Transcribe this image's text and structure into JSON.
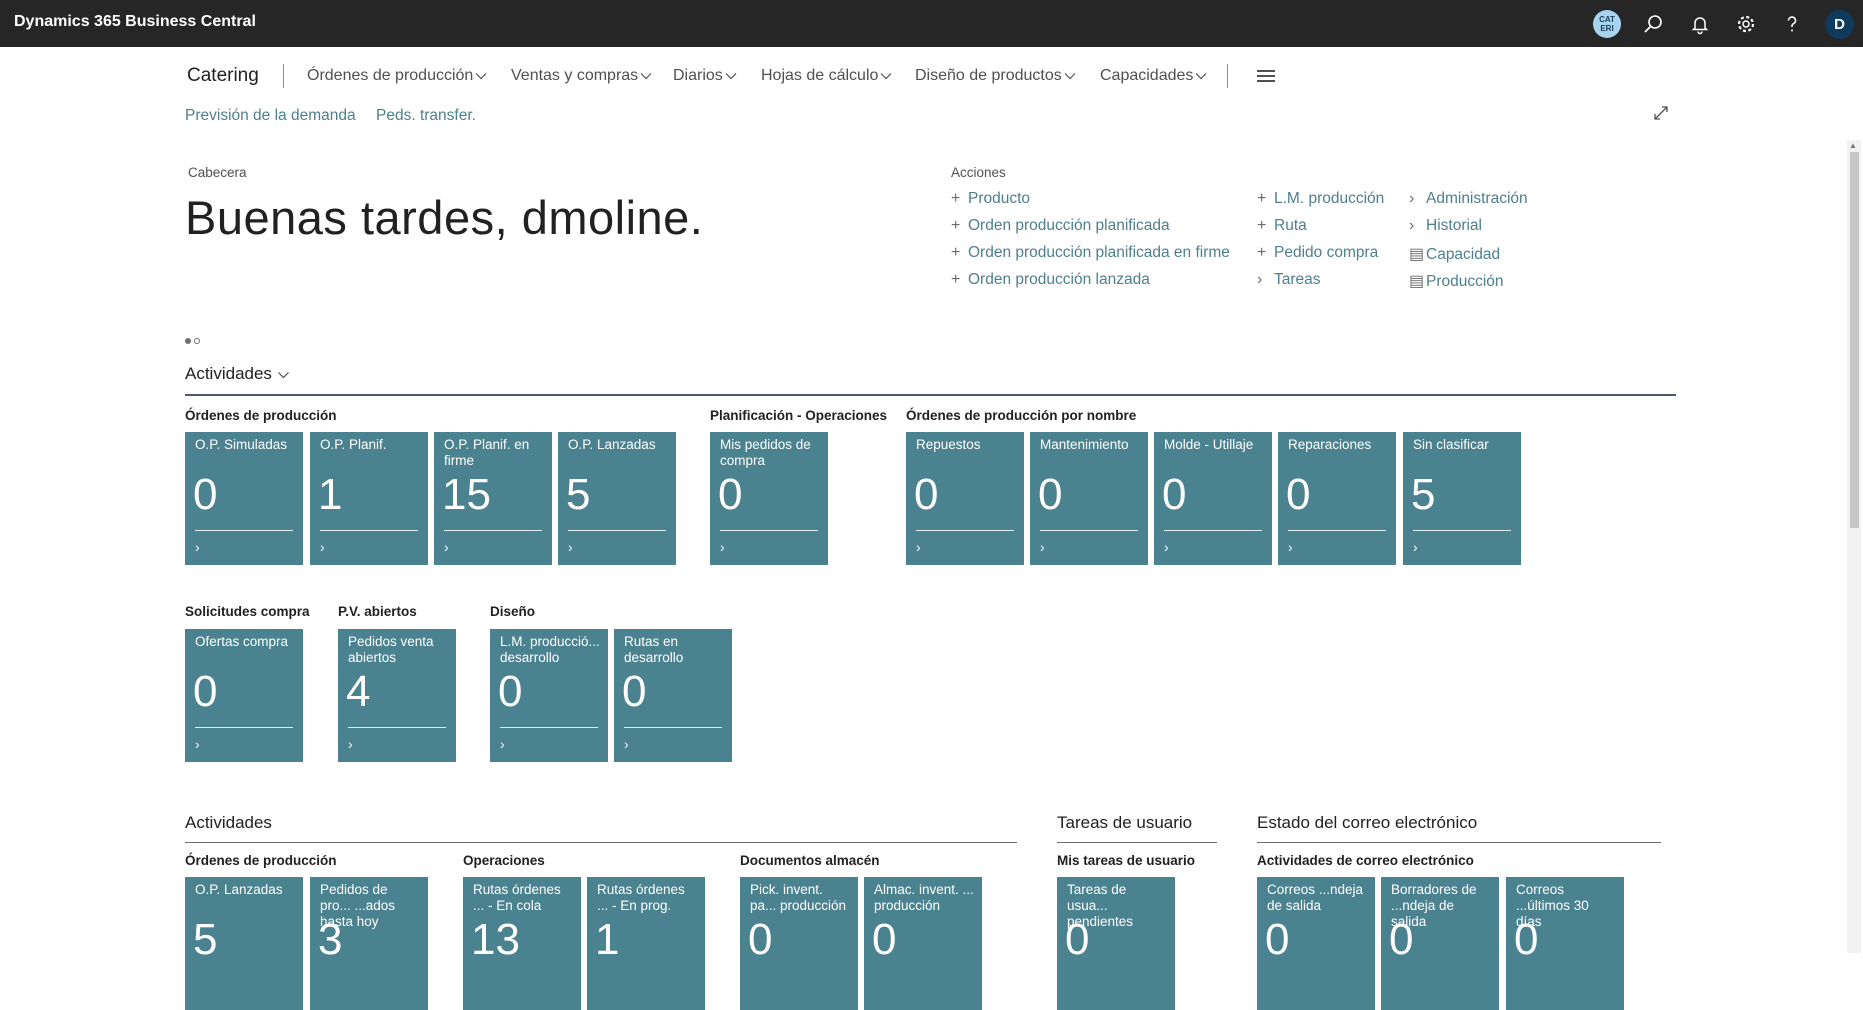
{
  "topbar": {
    "brand": "Dynamics 365 Business Central",
    "company_badge_line1": "CAT",
    "company_badge_line2": "ERI",
    "avatar_initial": "D"
  },
  "nav": {
    "title": "Catering",
    "items": [
      {
        "label": "Órdenes de producción"
      },
      {
        "label": "Ventas y compras"
      },
      {
        "label": "Diarios"
      },
      {
        "label": "Hojas de cálculo"
      },
      {
        "label": "Diseño de productos"
      },
      {
        "label": "Capacidades"
      }
    ],
    "sub_items": [
      "Previsión de la demanda",
      "Peds. transfer."
    ]
  },
  "headline": {
    "label": "Cabecera",
    "greeting": "Buenas tardes, dmoline."
  },
  "actions": {
    "label": "Acciones",
    "col1": [
      "Producto",
      "Orden producción planificada",
      "Orden producción planificada en firme",
      "Orden producción lanzada"
    ],
    "col2": [
      "L.M. producción",
      "Ruta",
      "Pedido compra",
      "Tareas"
    ],
    "col3": [
      "Administración",
      "Historial",
      "Capacidad",
      "Producción"
    ]
  },
  "activities": {
    "title": "Actividades",
    "groups": [
      {
        "label": "Órdenes de producción",
        "tiles": [
          {
            "title": "O.P. Simuladas",
            "value": "0"
          },
          {
            "title": "O.P. Planif.",
            "value": "1"
          },
          {
            "title": "O.P. Planif. en firme",
            "value": "15"
          },
          {
            "title": "O.P. Lanzadas",
            "value": "5"
          }
        ]
      },
      {
        "label": "Planificación - Operaciones",
        "tiles": [
          {
            "title": "Mis pedidos de compra",
            "value": "0"
          }
        ]
      },
      {
        "label": "Órdenes de producción por nombre",
        "tiles": [
          {
            "title": "Repuestos",
            "value": "0"
          },
          {
            "title": "Mantenimiento",
            "value": "0"
          },
          {
            "title": "Molde - Utillaje",
            "value": "0"
          },
          {
            "title": "Reparaciones",
            "value": "0"
          },
          {
            "title": "Sin clasificar",
            "value": "5"
          }
        ]
      },
      {
        "label": "Solicitudes compra",
        "tiles": [
          {
            "title": "Ofertas compra",
            "value": "0"
          }
        ]
      },
      {
        "label": "P.V. abiertos",
        "tiles": [
          {
            "title": "Pedidos venta abiertos",
            "value": "4"
          }
        ]
      },
      {
        "label": "Diseño",
        "tiles": [
          {
            "title": "L.M. producció... desarrollo",
            "value": "0"
          },
          {
            "title": "Rutas en desarrollo",
            "value": "0"
          }
        ]
      }
    ]
  },
  "activities2": {
    "title": "Actividades",
    "groups": [
      {
        "label": "Órdenes de producción",
        "tiles": [
          {
            "title": "O.P. Lanzadas",
            "value": "5"
          },
          {
            "title": "Pedidos de pro... ...ados hasta hoy",
            "value": "3"
          }
        ]
      },
      {
        "label": "Operaciones",
        "tiles": [
          {
            "title": "Rutas órdenes ... - En cola",
            "value": "13"
          },
          {
            "title": "Rutas órdenes ... - En prog.",
            "value": "1"
          }
        ]
      },
      {
        "label": "Documentos almacén",
        "tiles": [
          {
            "title": "Pick. invent. pa... producción",
            "value": "0"
          },
          {
            "title": "Almac. invent. ... producción",
            "value": "0"
          }
        ]
      }
    ]
  },
  "user_tasks": {
    "title": "Tareas de usuario",
    "group_label": "Mis tareas de usuario",
    "tiles": [
      {
        "title": "Tareas de usua... pendientes",
        "value": "0"
      }
    ]
  },
  "email_status": {
    "title": "Estado del correo electrónico",
    "group_label": "Actividades de correo electrónico",
    "tiles": [
      {
        "title": "Correos ...ndeja de salida",
        "value": "0"
      },
      {
        "title": "Borradores de ...ndeja de salida",
        "value": "0"
      },
      {
        "title": "Correos ...últimos 30 días",
        "value": "0"
      }
    ]
  },
  "colors": {
    "topbar": "#262626",
    "tile": "#4b8290",
    "link": "#4e7f8e"
  }
}
